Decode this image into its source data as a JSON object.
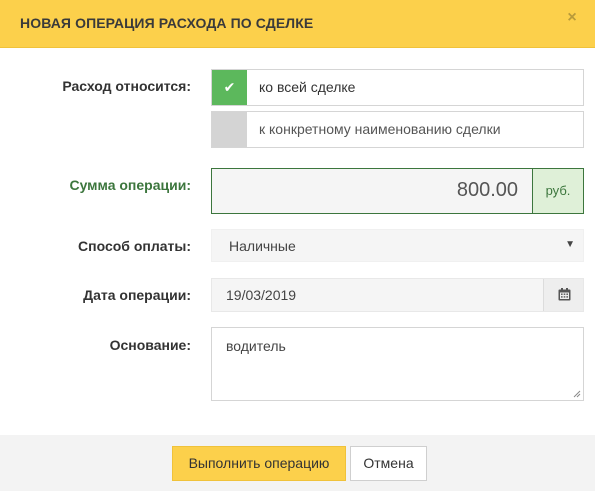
{
  "header": {
    "title": "НОВАЯ ОПЕРАЦИЯ РАСХОДА ПО СДЕЛКЕ",
    "close_glyph": "×"
  },
  "expense_scope": {
    "label": "Расход относится:",
    "options": [
      {
        "label": "ко всей сделке",
        "selected": true
      },
      {
        "label": "к конкретному наименованию сделки",
        "selected": false
      }
    ],
    "check_glyph": "✔"
  },
  "amount": {
    "label": "Сумма операции:",
    "value": "800.00",
    "currency": "руб."
  },
  "payment_method": {
    "label": "Способ оплаты:",
    "selected": "Наличные"
  },
  "operation_date": {
    "label": "Дата операции:",
    "value": "19/03/2019"
  },
  "basis": {
    "label": "Основание:",
    "value": "водитель"
  },
  "footer": {
    "submit_label": "Выполнить операцию",
    "cancel_label": "Отмена"
  },
  "colors": {
    "header_bg": "#fcd04b",
    "success_green": "#5cb85c",
    "label_green": "#3c763d",
    "addon_green_bg": "#dff0d8"
  }
}
